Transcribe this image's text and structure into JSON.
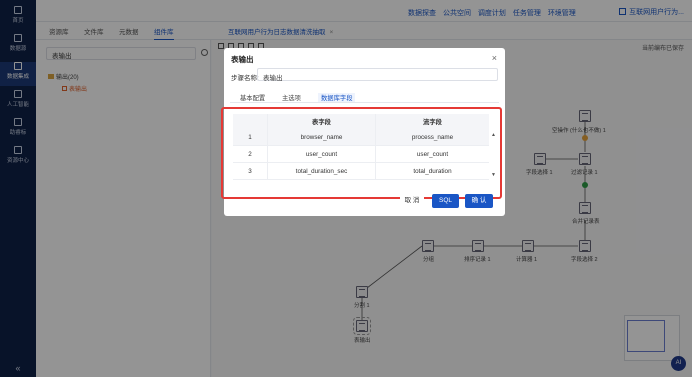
{
  "nav": {
    "items": [
      {
        "label": "首页",
        "icon": "home-icon"
      },
      {
        "label": "数据源",
        "icon": "database-icon"
      },
      {
        "label": "数据集成",
        "icon": "integration-icon"
      },
      {
        "label": "人工智能",
        "icon": "ai-icon"
      },
      {
        "label": "助睿标",
        "icon": "tag-icon"
      },
      {
        "label": "资源中心",
        "icon": "resource-icon"
      }
    ],
    "collapse": "«"
  },
  "topbar": {
    "menu": [
      "数据探查",
      "公共空间",
      "调度计划",
      "任务管理",
      "环境管理"
    ],
    "project": "互联网用户行为..."
  },
  "left_tabs": [
    "资源库",
    "文件库",
    "元数据",
    "组件库"
  ],
  "canvas_tab": {
    "title": "互联网用户行为日志数据清洗抽取",
    "close": "×"
  },
  "left_panel": {
    "search_value": "表输出",
    "tree": [
      {
        "label": "输出(20)"
      },
      {
        "label": "表输出"
      }
    ]
  },
  "canvas": {
    "autosave": "当前编布已保存",
    "nodes": {
      "empty_op": "空操作 (什么也不做) 1",
      "field_select_1": "字段选择 1",
      "filter_records_1": "过滤记录 1",
      "merge_records": "合并记录表",
      "field_select_2": "字段选择 2",
      "calculator_1": "计算器 1",
      "sort_records_1": "排序记录 1",
      "group": "分组",
      "split_1": "分割 1",
      "table_output": "表输出"
    },
    "ai_label": "AI"
  },
  "modal": {
    "title": "表输出",
    "close": "×",
    "step_label": "步骤名称:",
    "step_value": "表输出",
    "tabs": [
      "基本配置",
      "主选项",
      "数据库字段"
    ],
    "active_tab": 2,
    "columns": [
      "表字段",
      "流字段"
    ],
    "rows": [
      {
        "idx": "1",
        "table_field": "browser_name",
        "stream_field": "process_name"
      },
      {
        "idx": "2",
        "table_field": "user_count",
        "stream_field": "user_count"
      },
      {
        "idx": "3",
        "table_field": "total_duration_sec",
        "stream_field": "total_duration"
      }
    ],
    "scroll_up": "▲",
    "scroll_down": "▼",
    "buttons": {
      "cancel": "取 消",
      "sql": "SQL",
      "ok": "确 认"
    }
  },
  "colors": {
    "nav_bg": "#0f2147",
    "accent": "#1a56c5",
    "highlight_frame": "#e53935"
  }
}
